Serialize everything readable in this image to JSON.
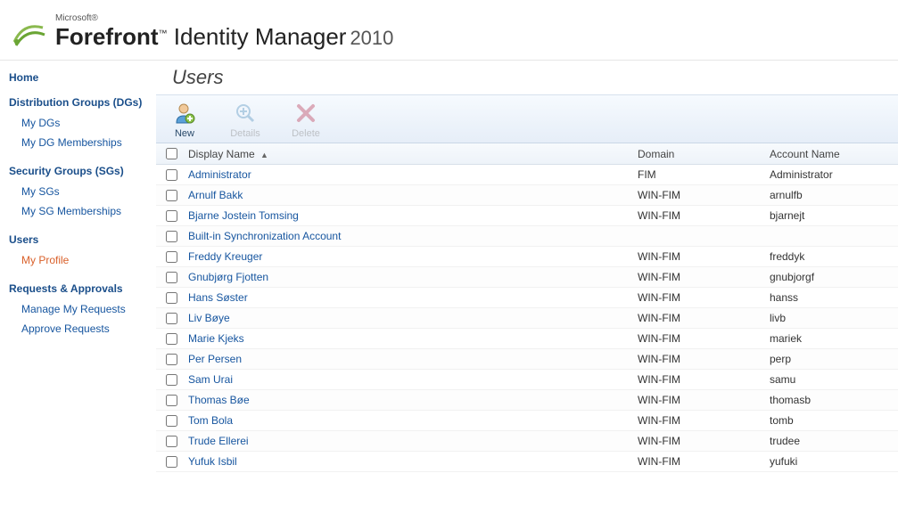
{
  "brand": {
    "ms": "Microsoft®",
    "product_bold": "Forefront",
    "product_tm": "™",
    "product_rest": " Identity Manager",
    "year": "2010"
  },
  "sidebar": {
    "home": "Home",
    "sections": [
      {
        "title": "Distribution Groups (DGs)",
        "items": [
          {
            "label": "My DGs"
          },
          {
            "label": "My DG Memberships"
          }
        ]
      },
      {
        "title": "Security Groups (SGs)",
        "items": [
          {
            "label": "My SGs"
          },
          {
            "label": "My SG Memberships"
          }
        ]
      },
      {
        "title": "Users",
        "items": [
          {
            "label": "My Profile",
            "active": true
          }
        ]
      },
      {
        "title": "Requests & Approvals",
        "items": [
          {
            "label": "Manage My Requests"
          },
          {
            "label": "Approve Requests"
          }
        ]
      }
    ]
  },
  "page": {
    "title": "Users"
  },
  "toolbar": {
    "new": "New",
    "details": "Details",
    "delete": "Delete"
  },
  "table": {
    "columns": {
      "display_name": "Display Name",
      "domain": "Domain",
      "account": "Account Name"
    },
    "rows": [
      {
        "name": "Administrator",
        "domain": "FIM",
        "account": "Administrator"
      },
      {
        "name": "Arnulf Bakk",
        "domain": "WIN-FIM",
        "account": "arnulfb"
      },
      {
        "name": "Bjarne Jostein Tomsing",
        "domain": "WIN-FIM",
        "account": "bjarnejt"
      },
      {
        "name": "Built-in Synchronization Account",
        "domain": "",
        "account": ""
      },
      {
        "name": "Freddy Kreuger",
        "domain": "WIN-FIM",
        "account": "freddyk"
      },
      {
        "name": "Gnubjørg Fjotten",
        "domain": "WIN-FIM",
        "account": "gnubjorgf"
      },
      {
        "name": "Hans Søster",
        "domain": "WIN-FIM",
        "account": "hanss"
      },
      {
        "name": "Liv Bøye",
        "domain": "WIN-FIM",
        "account": "livb"
      },
      {
        "name": "Marie Kjeks",
        "domain": "WIN-FIM",
        "account": "mariek"
      },
      {
        "name": "Per Persen",
        "domain": "WIN-FIM",
        "account": "perp"
      },
      {
        "name": "Sam Urai",
        "domain": "WIN-FIM",
        "account": "samu"
      },
      {
        "name": "Thomas Bøe",
        "domain": "WIN-FIM",
        "account": "thomasb"
      },
      {
        "name": "Tom Bola",
        "domain": "WIN-FIM",
        "account": "tomb"
      },
      {
        "name": "Trude Ellerei",
        "domain": "WIN-FIM",
        "account": "trudee"
      },
      {
        "name": "Yufuk Isbil",
        "domain": "WIN-FIM",
        "account": "yufuki"
      }
    ]
  }
}
